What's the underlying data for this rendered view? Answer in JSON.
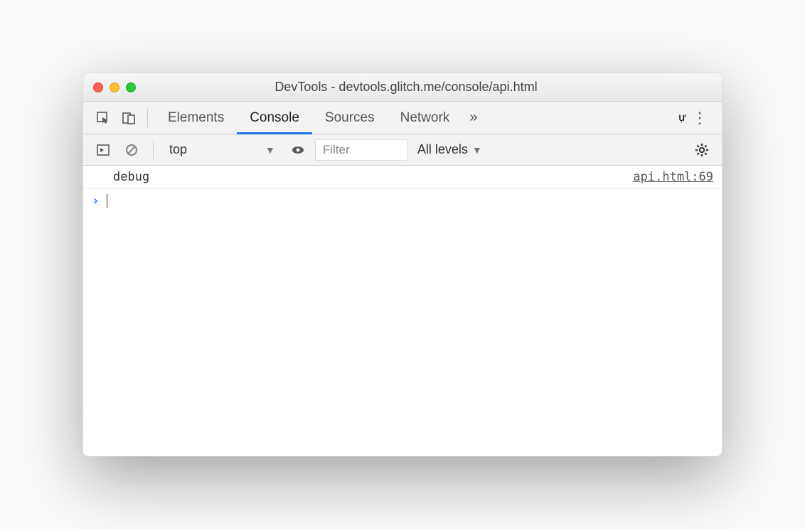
{
  "window": {
    "title": "DevTools - devtools.glitch.me/console/api.html"
  },
  "tabs": {
    "items": [
      "Elements",
      "Console",
      "Sources",
      "Network"
    ],
    "active": "Console",
    "more": "»"
  },
  "toolbar": {
    "context": "top",
    "filter_placeholder": "Filter",
    "levels_label": "All levels"
  },
  "console": {
    "log_message": "debug",
    "log_source": "api.html:69",
    "prompt": "›"
  }
}
